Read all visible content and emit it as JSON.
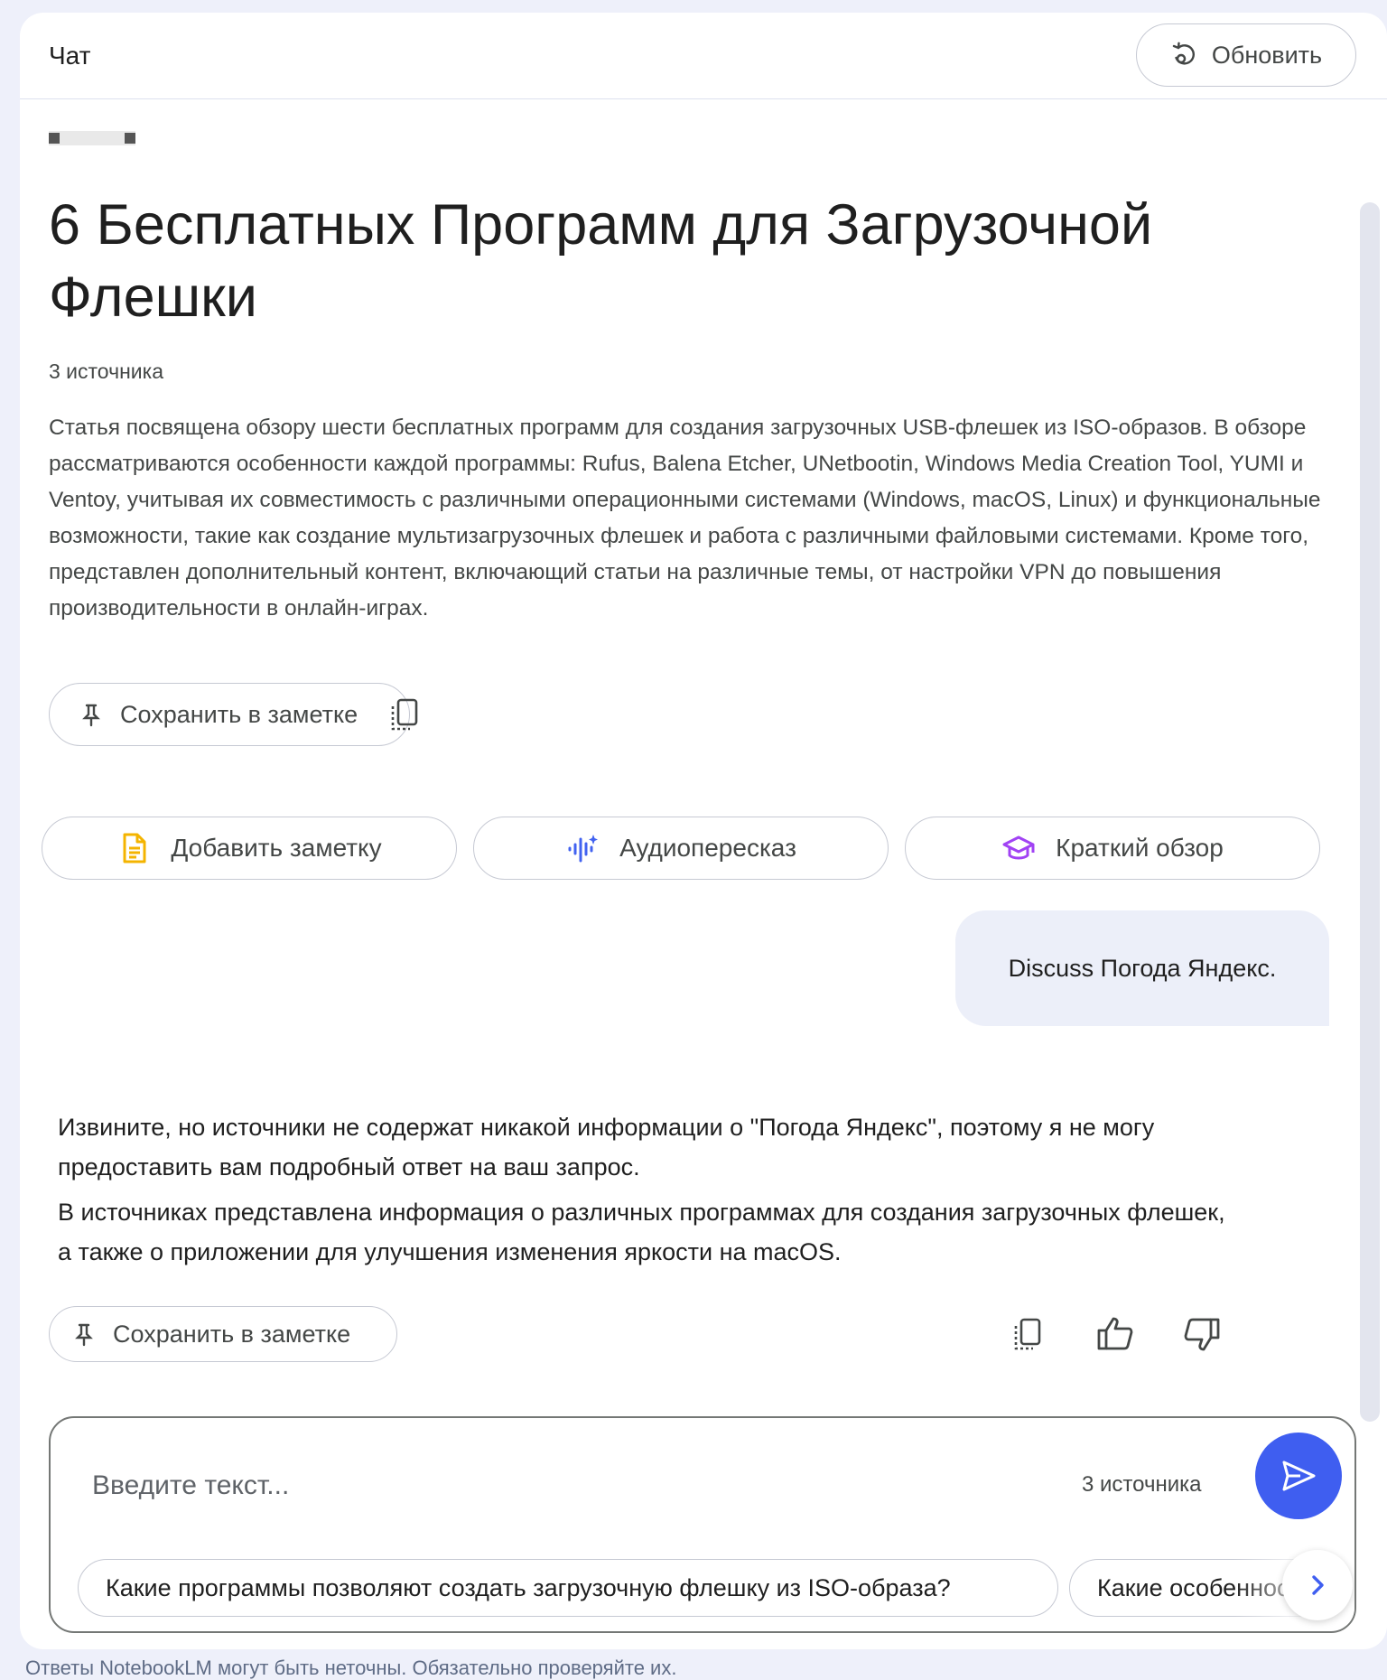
{
  "header": {
    "title": "Чат",
    "refresh_label": "Обновить"
  },
  "document": {
    "title": "6 Бесплатных Программ для Загрузочной Флешки",
    "sources_count": "3 источника",
    "summary": "Статья посвящена обзору шести бесплатных программ для создания загрузочных USB-флешек из ISO-образов. В обзоре рассматриваются особенности каждой программы: Rufus, Balena Etcher, UNetbootin, Windows Media Creation Tool, YUMI и Ventoy, учитывая их совместимость с различными операционными системами (Windows, macOS, Linux) и функциональные возможности, такие как создание мультизагрузочных флешек и работа с различными файловыми системами. Кроме того, представлен дополнительный контент, включающий статьи на различные темы, от настройки VPN до повышения производительности в онлайн-играх.",
    "save_note_label": "Сохранить в заметке"
  },
  "actions": [
    {
      "label": "Добавить заметку",
      "icon": "note-doc-icon",
      "color": "#f4b400"
    },
    {
      "label": "Аудиопересказ",
      "icon": "audio-wave-icon",
      "color": "#4162f0"
    },
    {
      "label": "Краткий обзор",
      "icon": "graduation-cap-icon",
      "color": "#a142f4"
    }
  ],
  "conversation": {
    "user_message": "Discuss Погода Яндекс.",
    "answer_paragraphs": [
      "Извините, но источники не содержат никакой информации о \"Погода Яндекс\", поэтому я не могу предоставить вам подробный ответ на ваш запрос.",
      "В источниках представлена информация о различных программах для создания загрузочных флешек, а также о приложении для улучшения изменения яркости на macOS."
    ],
    "save_note_label": "Сохранить в заметке"
  },
  "composer": {
    "placeholder": "Введите текст...",
    "sources_count": "3 источника",
    "suggestions": [
      "Какие программы позволяют создать загрузочную флешку из ISO-образа?",
      "Какие особенности"
    ]
  },
  "footer": {
    "disclaimer": "Ответы NotebookLM могут быть неточны. Обязательно проверяйте их."
  },
  "colors": {
    "accent": "#3f5ef0",
    "user_bubble": "#eceff9",
    "page_bg": "#eef0fa"
  }
}
